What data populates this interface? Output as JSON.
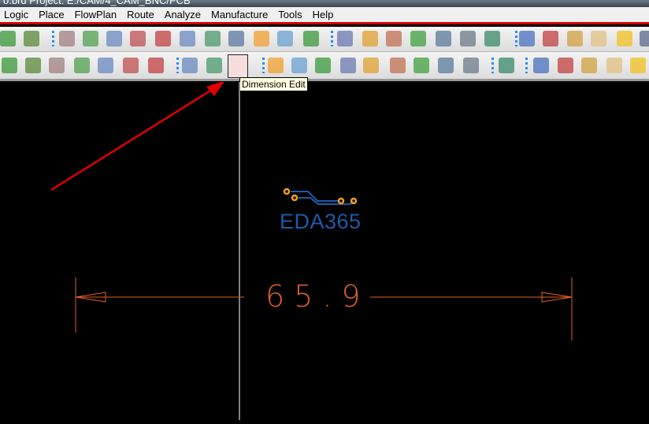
{
  "window": {
    "title": "o.brd  Project: E:/CAM/4_CAM_BNC/PCB"
  },
  "menu": [
    "Logic",
    "Place",
    "FlowPlan",
    "Route",
    "Analyze",
    "Manufacture",
    "Tools",
    "Help"
  ],
  "toolbar1": [
    "shape-icon",
    "pin-icon",
    "unrats-icon",
    "rats-icon",
    "zoom-points-icon",
    "zoom-fit-icon",
    "zoom-in-icon",
    "zoom-out-icon",
    "zoom-previous-icon",
    "zoom-world-icon",
    "redraw-icon",
    "3d-view-icon",
    "flip-icon",
    "grid-icon",
    "color-icon",
    "layer-visibility-icon",
    "stackup-icon",
    "cm-icon",
    "dfa-icon",
    "3d-canvas-icon",
    "info-icon",
    "report-icon",
    "measure-icon",
    "brush-icon",
    "highlight-icon",
    "dehighlight-icon"
  ],
  "toolbar2": [
    "select-icon",
    "shape-add-icon",
    "arc-icon",
    "rectangle-icon",
    "circle-icon",
    "void-icon",
    "delete-shape-icon",
    "placement-icon",
    "dimension-environment-icon",
    "dimension-edit-icon",
    "odb-export-icon",
    "padstack-icon",
    "tools-icon",
    "camera-icon",
    "renaming-icon",
    "docs-icon",
    "matrix-icon",
    "testpoint-icon",
    "array-icon",
    "flow-icon",
    "sch-report-icon",
    "sch-book-icon",
    "sch-chip-icon",
    "sch-check-icon",
    "sch-probe-icon"
  ],
  "tooltip": "Dimension Edit",
  "logo": {
    "text": "EDA365"
  },
  "dimension": {
    "value": "65.9"
  },
  "colors": {
    "dimension": "#e0602a",
    "logo": "#1e5aa8",
    "pad": "#f0a020",
    "arrow": "#e00000"
  }
}
